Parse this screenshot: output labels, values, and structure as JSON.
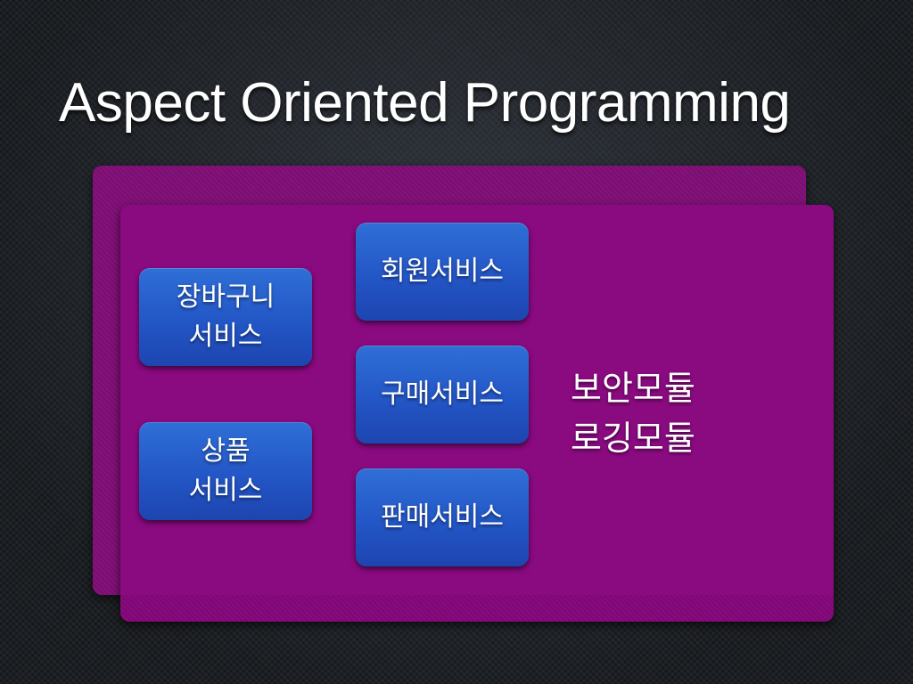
{
  "slide": {
    "title": "Aspect Oriented Programming"
  },
  "services": {
    "cart": {
      "line1": "장바구니",
      "line2": "서비스"
    },
    "product": {
      "line1": "상품",
      "line2": "서비스"
    },
    "member": {
      "label": "회원서비스"
    },
    "purchase": {
      "label": "구매서비스"
    },
    "sales": {
      "label": "판매서비스"
    }
  },
  "aspects": {
    "security": "보안모듈",
    "logging": "로깅모듈"
  },
  "colors": {
    "panel": "#8a0a80",
    "service_box": "#2356c6",
    "background": "#1b1e22",
    "text": "#ffffff"
  }
}
